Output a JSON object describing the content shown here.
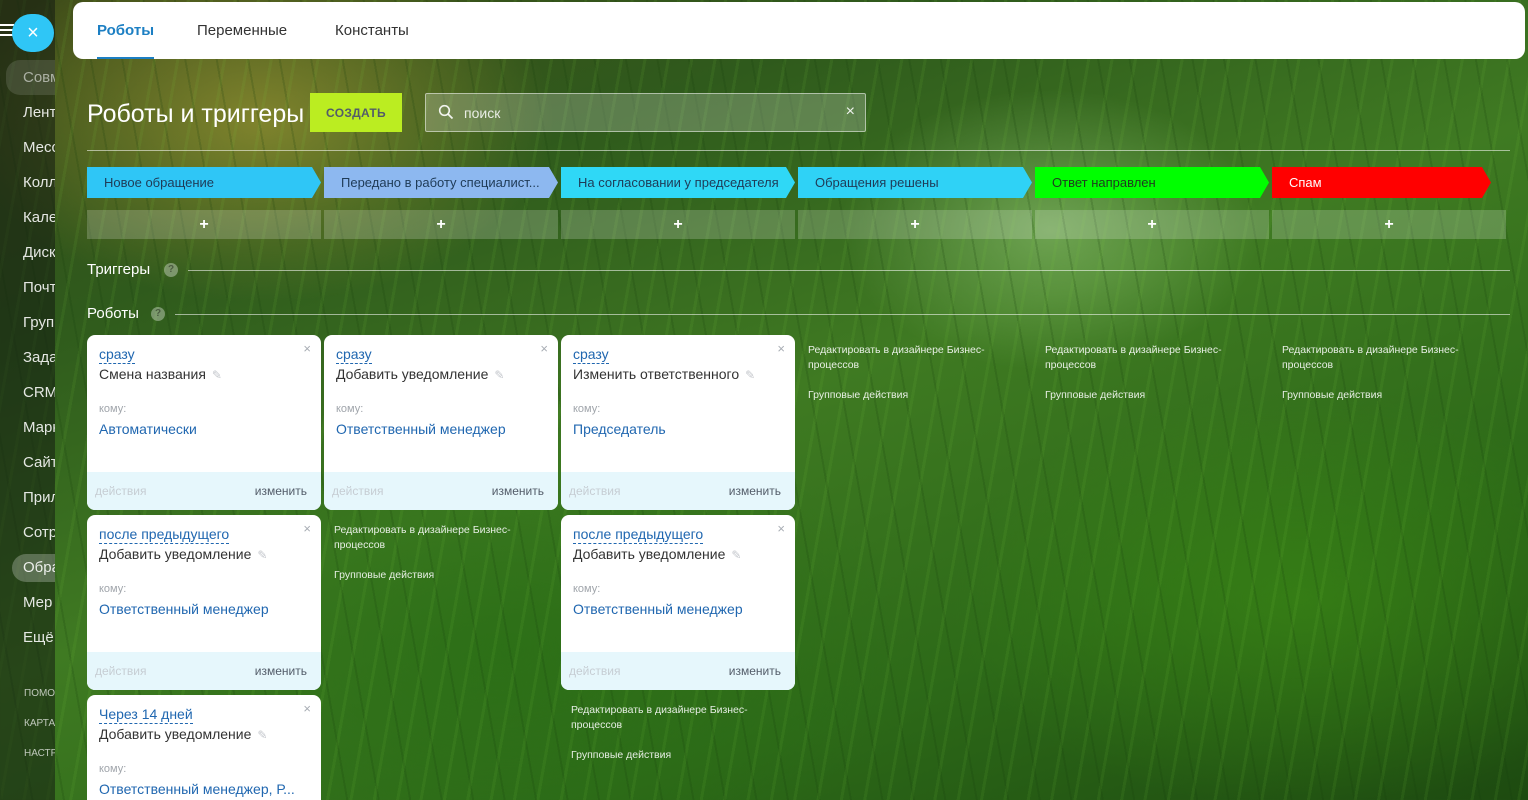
{
  "sidebar": {
    "close_icon": "×",
    "items": [
      "Совм",
      "Лент",
      "Месс",
      "Колл",
      "Кале",
      "Диск",
      "Почт",
      "Груп",
      "Зада",
      "CRM",
      "Марк",
      "Сайт",
      "Прил",
      "Сотр",
      "Обра",
      "Мер",
      "Ещё"
    ],
    "small": [
      "ПОМО",
      "КАРТА",
      "НАСТР"
    ]
  },
  "tabs": [
    "Роботы",
    "Переменные",
    "Константы"
  ],
  "header": {
    "title": "Роботы и триггеры",
    "create_label": "СОЗДАТЬ",
    "search_placeholder": "поиск",
    "search_clear": "×"
  },
  "stages": [
    {
      "name": "Новое обращение",
      "color": "#2fc6f6",
      "text_color": "#1f3b57"
    },
    {
      "name": "Передано в работу специалист...",
      "color": "#8db8f0",
      "text_color": "#1f3b57"
    },
    {
      "name": "На согласовании у председателя",
      "color": "#2fd8f6",
      "text_color": "#1f3b57"
    },
    {
      "name": "Обращения решены",
      "color": "#2fd2f6",
      "text_color": "#1f3b57"
    },
    {
      "name": "Ответ направлен",
      "color": "#00ff00",
      "text_color": "#1f3b1f"
    },
    {
      "name": "Спам",
      "color": "#ff0000",
      "text_color": "#ffffff"
    }
  ],
  "stage_add": "+",
  "sections": {
    "triggers": "Триггеры",
    "robots": "Роботы",
    "help": "?"
  },
  "cards": [
    {
      "condition": "сразу",
      "title": "Смена названия",
      "to_label": "кому:",
      "to_value": "Автоматически",
      "actions": "действия",
      "edit": "изменить",
      "close": "×"
    },
    {
      "condition": "сразу",
      "title": "Добавить уведомление",
      "to_label": "кому:",
      "to_value": "Ответственный менеджер",
      "actions": "действия",
      "edit": "изменить",
      "close": "×"
    },
    {
      "condition": "сразу",
      "title": "Изменить ответственного",
      "to_label": "кому:",
      "to_value": "Председатель",
      "actions": "действия",
      "edit": "изменить",
      "close": "×"
    },
    {
      "condition": "после предыдущего",
      "title": "Добавить уведомление",
      "to_label": "кому:",
      "to_value": "Ответственный менеджер",
      "actions": "действия",
      "edit": "изменить",
      "close": "×"
    },
    {
      "condition": "после предыдущего",
      "title": "Добавить уведомление",
      "to_label": "кому:",
      "to_value": "Ответственный менеджер",
      "actions": "действия",
      "edit": "изменить",
      "close": "×"
    },
    {
      "condition": "Через 14 дней",
      "title": "Добавить уведомление",
      "to_label": "кому:",
      "to_value": "Ответственный менеджер, Р...",
      "actions": "действия",
      "edit": "изменить",
      "close": "×"
    }
  ],
  "bp_links": {
    "edit_designer": "Редактировать в дизайнере Бизнес-процессов",
    "group_actions": "Групповые действия"
  }
}
